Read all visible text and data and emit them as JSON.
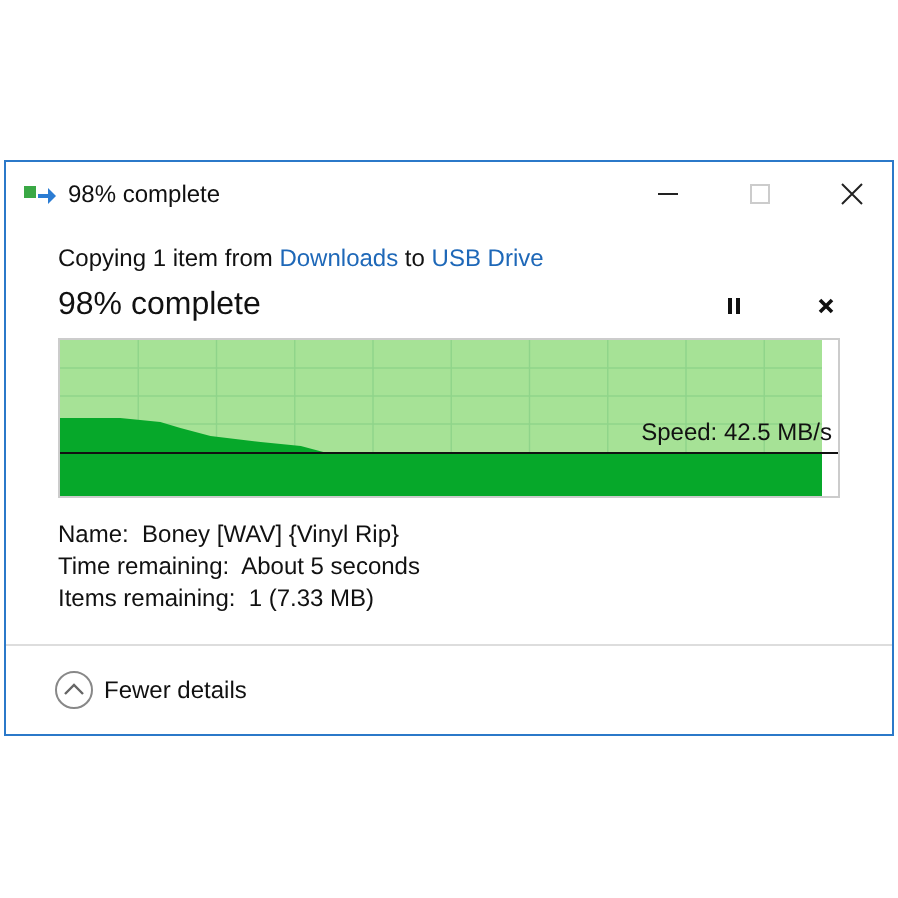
{
  "window": {
    "title": "98% complete"
  },
  "header": {
    "prefix": "Copying 1 item from ",
    "source": "Downloads",
    "middle": " to ",
    "destination": "USB Drive"
  },
  "progress": {
    "title": "98% complete",
    "level": 0.98,
    "speed": "Speed: 42.5 MB/s"
  },
  "details": [
    {
      "label": "Name:",
      "value": "Boney [WAV] {Vinyl Rip}"
    },
    {
      "label": "Time remaining:",
      "value": "About 5 seconds"
    },
    {
      "label": "Items remaining:",
      "value": "1 (7.33 MB)"
    }
  ],
  "footer": {
    "label": "Fewer details",
    "expanded": true
  }
}
